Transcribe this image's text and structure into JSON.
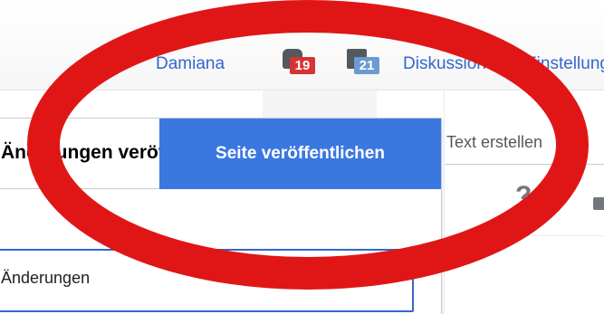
{
  "topbar": {
    "username": "Damiana",
    "notifications": {
      "alerts_count": "19",
      "notices_count": "21"
    },
    "links": {
      "talk": "Diskussion",
      "preferences": "Einstellungen"
    }
  },
  "dialog": {
    "title": "Änderungen veröffentlichen",
    "publish_button": "Seite veröffentlichen",
    "summary_value": "Änderungen"
  },
  "right_panel": {
    "tab_label": "Text erstellen",
    "help_symbol": "?"
  },
  "colors": {
    "accent": "#3366cc",
    "publish": "#3a78e0",
    "annotation_red": "#e01616",
    "badge_red": "#d73333",
    "badge_blue": "#6b9bd1"
  },
  "icons": [
    "bell-icon",
    "tray-icon",
    "help-icon",
    "lock-icon"
  ]
}
